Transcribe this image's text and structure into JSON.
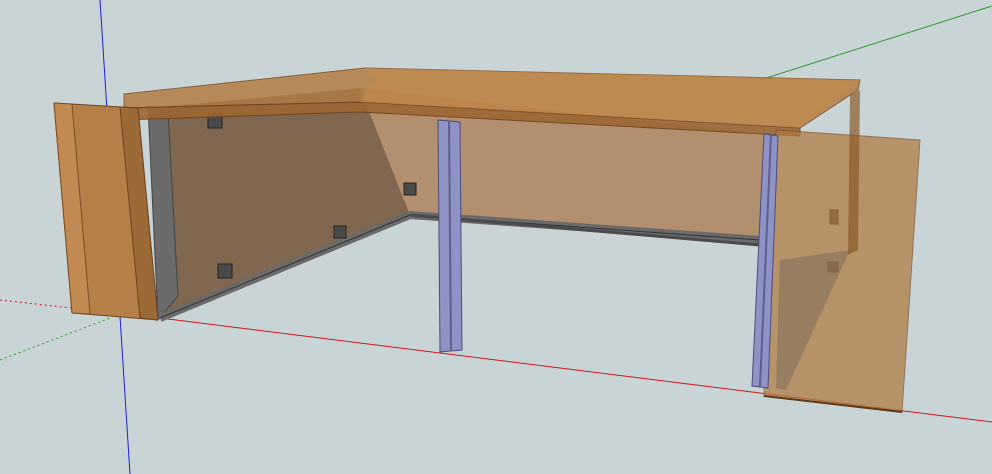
{
  "viewport": {
    "background_color": "#c9d4d6",
    "axis_colors": {
      "red_axis": "#d01818",
      "green_axis": "#2a9a2a",
      "blue_axis": "#2020d0"
    },
    "material_colors": {
      "panel_front": "#a8723a",
      "panel_edge": "#8a5a2a",
      "tabletop_glass": "#b07a3e",
      "frame_steel": "#6e6e6e",
      "support_beam": "#8e92c4",
      "back_panel_glass": "#8c6a48"
    }
  }
}
